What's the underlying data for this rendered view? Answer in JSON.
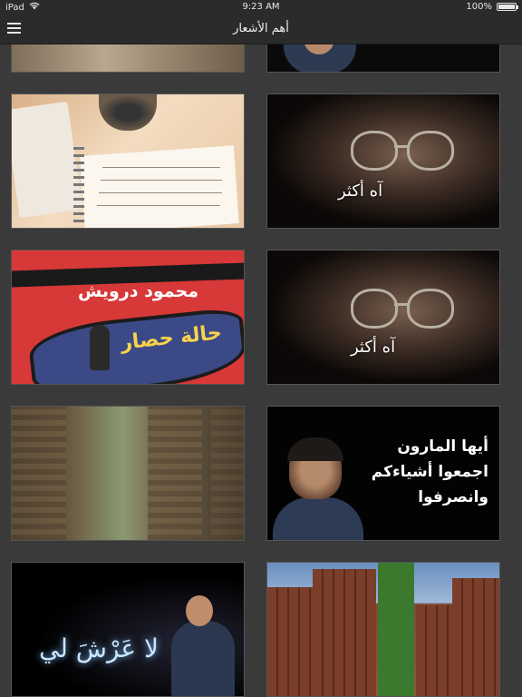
{
  "status_bar": {
    "carrier": "iPad",
    "wifi_icon": "wifi-icon",
    "time": "9:23 AM",
    "battery": "100%",
    "battery_level": 1.0
  },
  "nav": {
    "title": "أهم الأشعار",
    "menu_icon": "hamburger-menu-icon"
  },
  "tiles": {
    "poem_card_1": {
      "caption": "آه أكثر"
    },
    "poem_card_2": {
      "caption": "آه أكثر"
    },
    "book_cover": {
      "author": "محمود درويش",
      "title": "حالة حصار"
    },
    "poem_text_card": {
      "line1": "أيها المارون",
      "line2": "اجمعوا أشياءكم",
      "line3": "وانصرفوا"
    },
    "throne_card": {
      "caption": "لا عَرْشَ لي"
    }
  }
}
